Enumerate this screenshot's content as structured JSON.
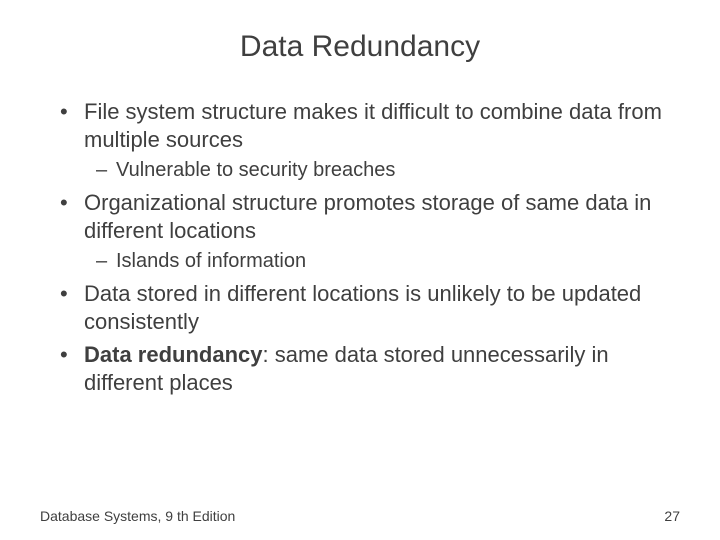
{
  "title": "Data Redundancy",
  "bullets": {
    "b1": "File system structure makes it difficult to combine data from multiple sources",
    "b1_sub1": "Vulnerable to security breaches",
    "b2": "Organizational structure promotes storage of same data in different locations",
    "b2_sub1": "Islands of information",
    "b3": "Data stored in different locations is unlikely to be updated consistently",
    "b4_term": "Data redundancy",
    "b4_rest": ": same data stored unnecessarily in different places"
  },
  "footer": {
    "left": "Database Systems, 9 th Edition",
    "right": "27"
  }
}
